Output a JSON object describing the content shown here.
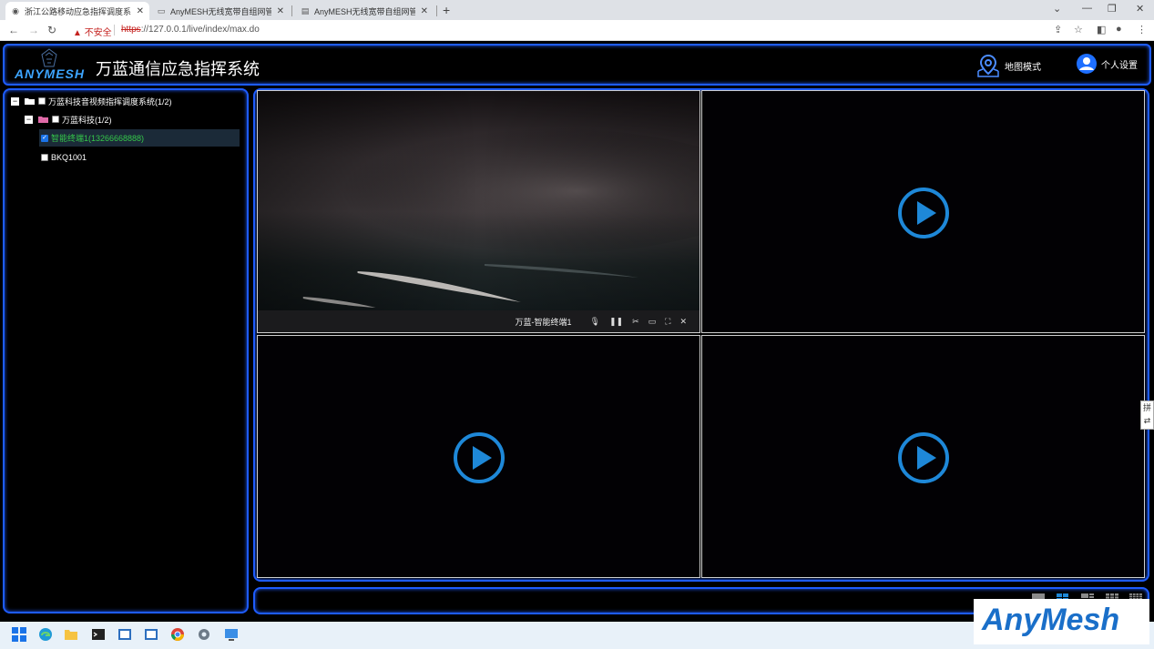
{
  "browser": {
    "tabs": [
      {
        "label": "浙江公路移动应急指挥调度系统",
        "icon": "globe-icon"
      },
      {
        "label": "AnyMESH无线宽带自组网管理系统",
        "icon": "doc-icon"
      },
      {
        "label": "AnyMESH无线宽带自组网管理系统",
        "icon": "doc-icon"
      }
    ],
    "new_tab": "+",
    "security_label": "不安全",
    "url_scheme": "https",
    "url_rest": "://127.0.0.1/live/index/max.do"
  },
  "header": {
    "logo_text": "ANYMESH",
    "title": "万蓝通信应急指挥系统",
    "map_mode": "地图模式",
    "user_settings": "个人设置"
  },
  "tree": {
    "root": "万蓝科技音视频指挥调度系统(1/2)",
    "group": "万蓝科技(1/2)",
    "items": [
      {
        "label": "智能终端1(13266668888)",
        "checked": true,
        "online": true
      },
      {
        "label": "BKQ1001",
        "checked": false,
        "online": false
      }
    ]
  },
  "video": {
    "active_name": "万蓝-智能终端1",
    "controls": [
      "mic-icon",
      "pause-icon",
      "scissors-icon",
      "record-icon",
      "fullscreen-icon",
      "close-icon"
    ]
  },
  "ime": {
    "char": "拼"
  },
  "watermark": "AnyMesh",
  "colors": {
    "accent": "#1e5cff",
    "play": "#1e88d8",
    "online": "#35c84a"
  }
}
